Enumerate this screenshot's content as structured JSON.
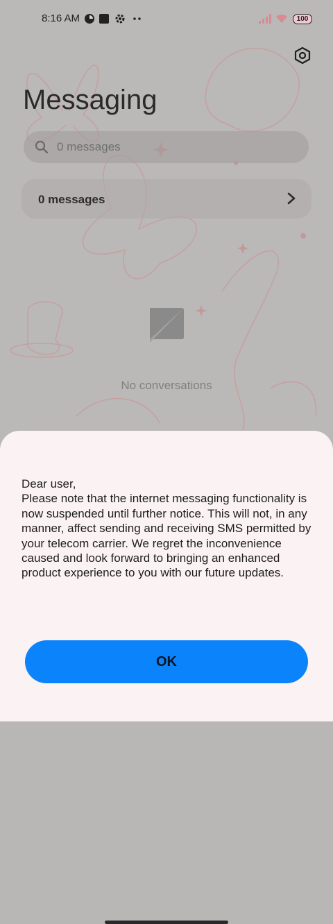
{
  "status_bar": {
    "time": "8:16 AM",
    "battery": "100",
    "icons": [
      "data-saver-icon",
      "app-notification-icon",
      "gear-icon",
      "more-dots-icon",
      "signal-icon",
      "wifi-icon",
      "battery-icon"
    ]
  },
  "header": {
    "title": "Messaging",
    "settings_icon": "settings-hex-icon"
  },
  "search": {
    "placeholder": "0 messages",
    "icon": "search-icon"
  },
  "summary_card": {
    "label": "0 messages",
    "icon": "chevron-right-icon"
  },
  "empty_state": {
    "icon": "message-bubble-icon",
    "text": "No conversations"
  },
  "dialog": {
    "message": "Dear user,\nPlease note that the internet messaging functionality is now suspended until further notice. This will not, in any manner, affect sending and receiving SMS permitted by your telecom carrier. We regret the inconvenience caused and look forward to bringing an enhanced product experience to you with our future updates.",
    "ok_label": "OK"
  },
  "colors": {
    "accent": "#0b84fb",
    "sheet_bg": "#fbf3f3",
    "dim_bg": "#b9b6b6"
  }
}
